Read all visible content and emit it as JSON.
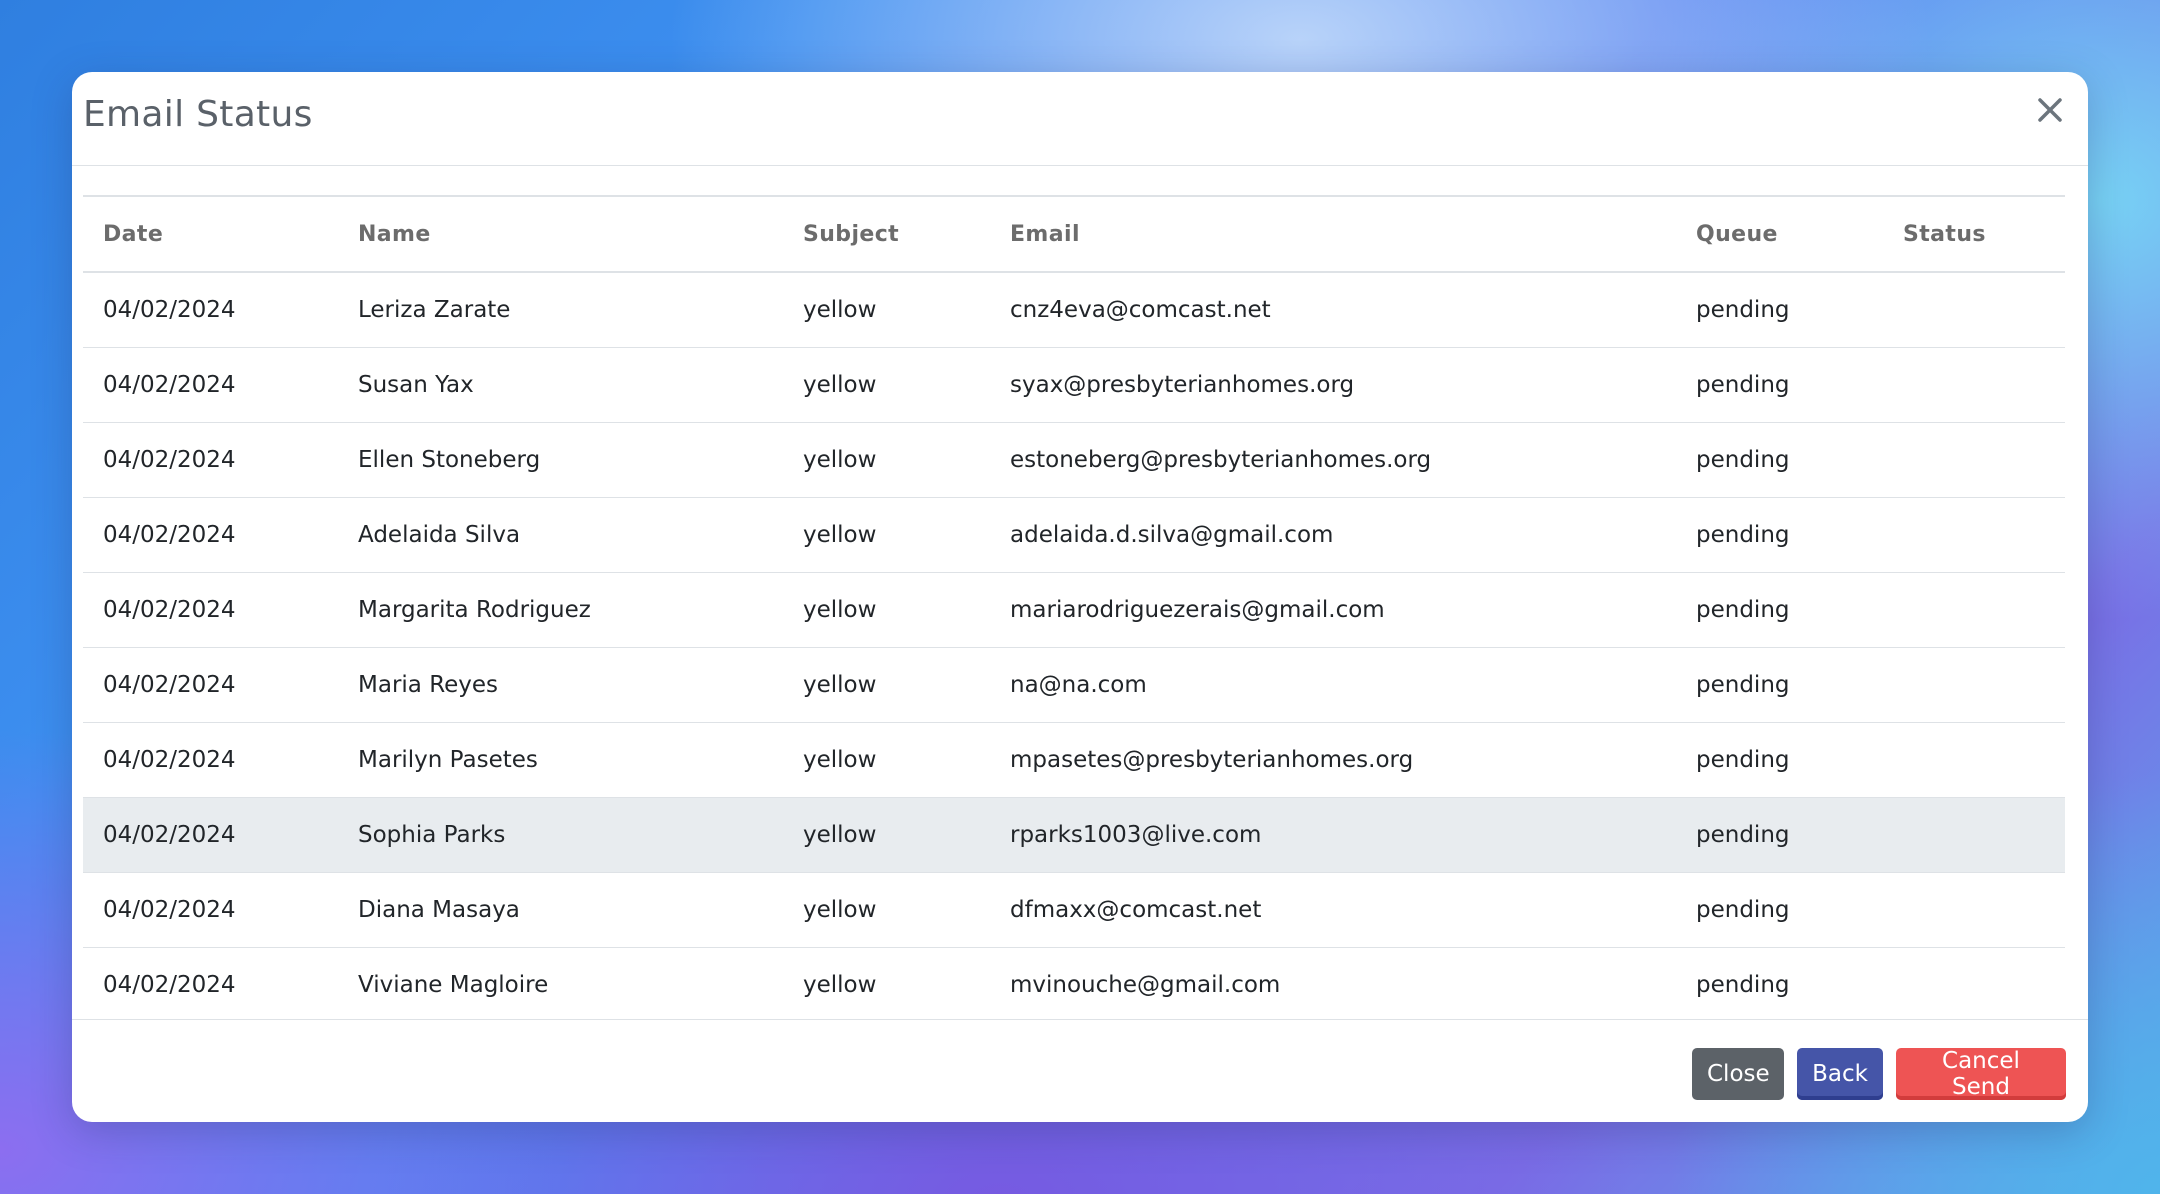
{
  "modal": {
    "title": "Email Status",
    "close_icon": "close-icon"
  },
  "table": {
    "columns": [
      "Date",
      "Name",
      "Subject",
      "Email",
      "Queue",
      "Status"
    ],
    "rows": [
      {
        "date": "04/02/2024",
        "name": "Leriza Zarate",
        "subject": "yellow",
        "email": "cnz4eva@comcast.net",
        "queue": "pending",
        "status": ""
      },
      {
        "date": "04/02/2024",
        "name": "Susan Yax",
        "subject": "yellow",
        "email": "syax@presbyterianhomes.org",
        "queue": "pending",
        "status": ""
      },
      {
        "date": "04/02/2024",
        "name": "Ellen Stoneberg",
        "subject": "yellow",
        "email": "estoneberg@presbyterianhomes.org",
        "queue": "pending",
        "status": ""
      },
      {
        "date": "04/02/2024",
        "name": "Adelaida Silva",
        "subject": "yellow",
        "email": "adelaida.d.silva@gmail.com",
        "queue": "pending",
        "status": ""
      },
      {
        "date": "04/02/2024",
        "name": "Margarita Rodriguez",
        "subject": "yellow",
        "email": "mariarodriguezerais@gmail.com",
        "queue": "pending",
        "status": ""
      },
      {
        "date": "04/02/2024",
        "name": "Maria Reyes",
        "subject": "yellow",
        "email": "na@na.com",
        "queue": "pending",
        "status": ""
      },
      {
        "date": "04/02/2024",
        "name": "Marilyn Pasetes",
        "subject": "yellow",
        "email": "mpasetes@presbyterianhomes.org",
        "queue": "pending",
        "status": ""
      },
      {
        "date": "04/02/2024",
        "name": "Sophia Parks",
        "subject": "yellow",
        "email": "rparks1003@live.com",
        "queue": "pending",
        "status": "",
        "highlighted": true
      },
      {
        "date": "04/02/2024",
        "name": "Diana Masaya",
        "subject": "yellow",
        "email": "dfmaxx@comcast.net",
        "queue": "pending",
        "status": ""
      },
      {
        "date": "04/02/2024",
        "name": "Viviane Magloire",
        "subject": "yellow",
        "email": "mvinouche@gmail.com",
        "queue": "pending",
        "status": ""
      }
    ]
  },
  "footer": {
    "close_label": "Close",
    "back_label": "Back",
    "cancel_send_label": "Cancel Send"
  },
  "colors": {
    "close_button": "#5c6268",
    "back_button": "#4555a8",
    "cancel_send_button": "#ee5454",
    "highlight_row": "#e8ecef"
  }
}
